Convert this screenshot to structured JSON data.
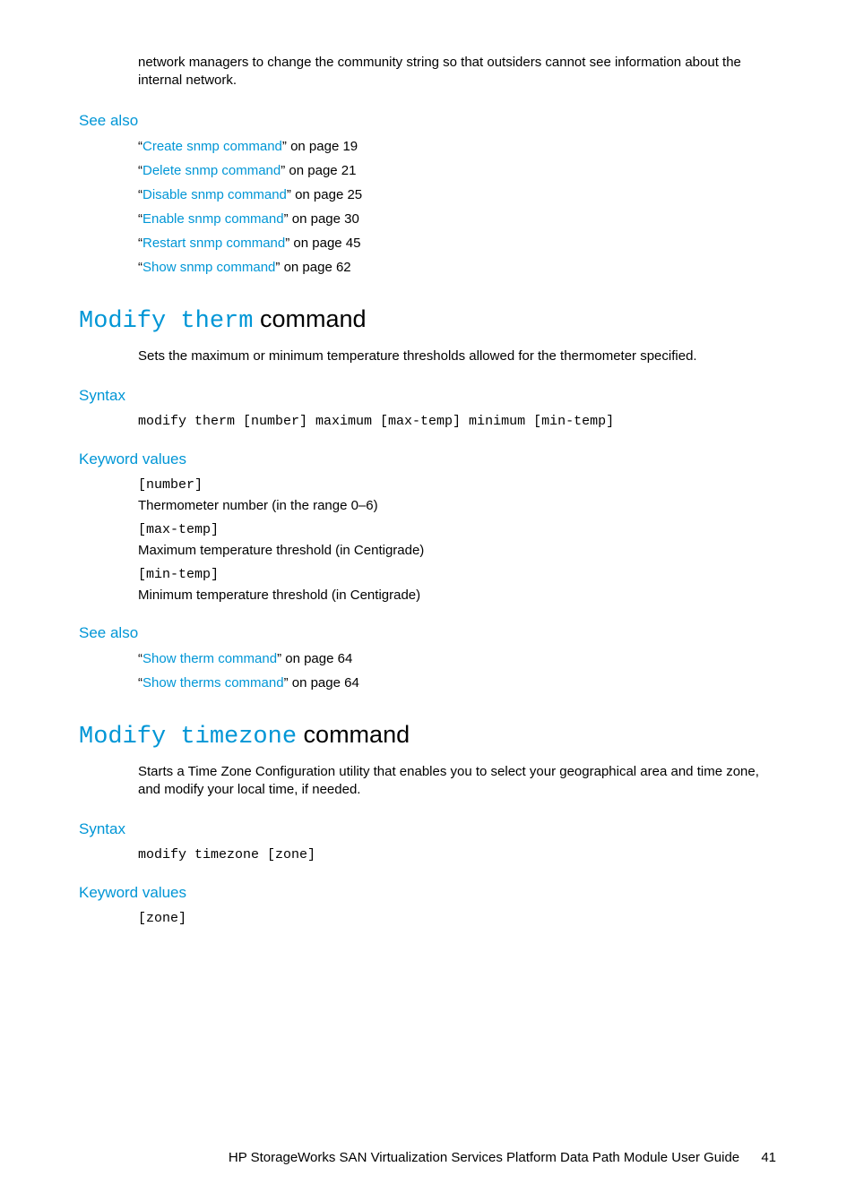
{
  "intro_para": "network managers to change the community string so that outsiders cannot see information about the internal network.",
  "seeAlso1": {
    "heading": "See also",
    "items": [
      {
        "link": "Create snmp command",
        "page": " on page 19"
      },
      {
        "link": "Delete snmp command",
        "page": " on page 21"
      },
      {
        "link": "Disable snmp command",
        "page": " on page 25"
      },
      {
        "link": "Enable snmp command",
        "page": " on page 30"
      },
      {
        "link": "Restart snmp command",
        "page": " on page 45"
      },
      {
        "link": "Show snmp command",
        "page": " on page 62"
      }
    ]
  },
  "section1": {
    "title_mono": "Modify therm",
    "title_rest": " command",
    "desc": "Sets the maximum or minimum temperature thresholds allowed for the thermometer specified.",
    "syntax_h": "Syntax",
    "syntax": "modify therm [number] maximum [max-temp] minimum [min-temp]",
    "kw_h": "Keyword values",
    "kws": [
      {
        "code": "[number]",
        "desc": "Thermometer number (in the range 0–6)"
      },
      {
        "code": "[max-temp]",
        "desc": "Maximum temperature threshold (in Centigrade)"
      },
      {
        "code": "[min-temp]",
        "desc": "Minimum temperature threshold (in Centigrade)"
      }
    ],
    "seeAlso": {
      "heading": "See also",
      "items": [
        {
          "link": "Show therm command",
          "page": " on page 64"
        },
        {
          "link": "Show therms command",
          "page": " on page 64"
        }
      ]
    }
  },
  "section2": {
    "title_mono": "Modify timezone",
    "title_rest": " command",
    "desc": "Starts a Time Zone Configuration utility that enables you to select your geographical area and time zone, and modify your local time, if needed.",
    "syntax_h": "Syntax",
    "syntax": "modify timezone [zone]",
    "kw_h": "Keyword values",
    "kws": [
      {
        "code": "[zone]"
      }
    ]
  },
  "footer": {
    "title": "HP StorageWorks SAN Virtualization Services Platform Data Path Module User Guide",
    "page": "41"
  },
  "quote_open": "“",
  "quote_close": "”"
}
